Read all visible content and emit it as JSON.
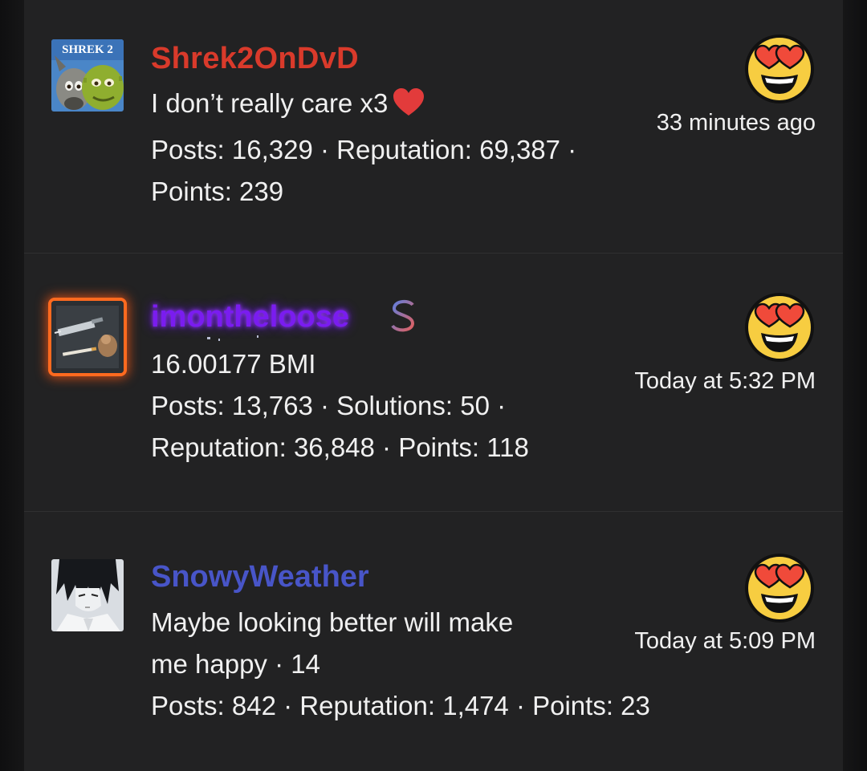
{
  "posts": [
    {
      "username": "Shrek2OnDvD",
      "username_color": "#d93a2b",
      "avatar_icon": "shrek2-avatar-icon",
      "avatar_text": "SHREK 2",
      "custom_title": "I don’t really care x3",
      "title_emoji": "heart-icon",
      "stats_line1": "Posts: 16,329 · Reputation: 69,387 ·",
      "stats_line2": "Points: 239",
      "reaction_icon": "heart-eyes-emoji-icon",
      "timestamp": "33 minutes ago"
    },
    {
      "username": "imontheloose",
      "username_color": "#7a1cf0",
      "avatar_icon": "syringe-avatar-icon",
      "badge_icon": "dollar-sign-icon",
      "custom_title": "16.00177 BMI",
      "stats_line1": "Posts: 13,763 · Solutions: 50 ·",
      "stats_line2": "Reputation: 36,848 · Points: 118",
      "reaction_icon": "heart-eyes-emoji-icon",
      "timestamp": "Today at 5:32 PM"
    },
    {
      "username": "SnowyWeather",
      "username_color": "#4855c8",
      "avatar_icon": "anime-character-avatar-icon",
      "custom_title_line1": "Maybe looking better will make",
      "custom_title_line2": "me happy · 14",
      "stats_line1": "Posts: 842 · Reputation: 1,474 · Points: 23",
      "reaction_icon": "heart-eyes-emoji-icon",
      "timestamp": "Today at 5:09 PM"
    }
  ]
}
